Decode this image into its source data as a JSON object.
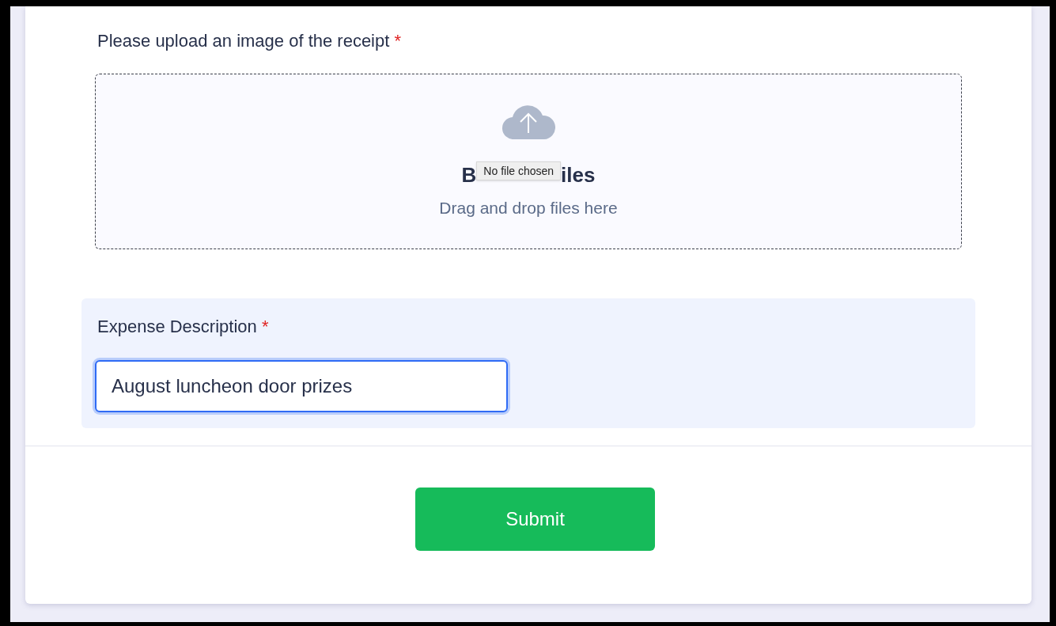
{
  "upload": {
    "label": "Please upload an image of the receipt",
    "required_mark": "*",
    "title_start": "B",
    "tooltip": "No file chosen",
    "title_end": "iles",
    "hint": "Drag and drop files here"
  },
  "description": {
    "label": "Expense Description",
    "required_mark": "*",
    "value": "August luncheon door prizes",
    "focused": true
  },
  "submit": {
    "label": "Submit"
  }
}
